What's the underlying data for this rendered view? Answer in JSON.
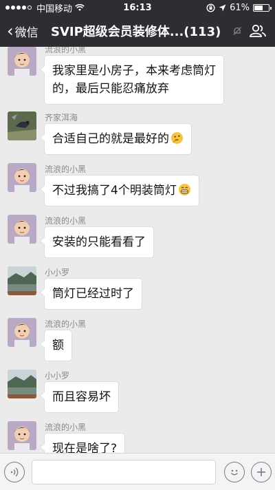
{
  "status_bar": {
    "carrier": "中国移动",
    "time": "16:13",
    "battery": "61%",
    "battery_level": 0.61
  },
  "nav": {
    "back_label": "微信",
    "title": "SVIP超级会员装修体...(113)"
  },
  "messages": [
    {
      "sender": "流浪的小黑",
      "avatar": "child-photo",
      "lines": [
        "我家里是小房子，本来考虑筒灯",
        "的，最后只能忍痛放弃"
      ]
    },
    {
      "sender": "齐家洱海",
      "avatar": "bird-photo",
      "lines": [
        "合适自己的就是最好的"
      ],
      "emoji": "thinking-face"
    },
    {
      "sender": "流浪的小黑",
      "avatar": "child-photo",
      "lines": [
        "不过我搞了4个明装筒灯"
      ],
      "emoji": "grinning-face"
    },
    {
      "sender": "流浪的小黑",
      "avatar": "child-photo",
      "lines": [
        "安装的只能看看了"
      ]
    },
    {
      "sender": "小小罗",
      "avatar": "lake-photo",
      "lines": [
        "筒灯已经过时了"
      ]
    },
    {
      "sender": "流浪的小黑",
      "avatar": "child-photo",
      "lines": [
        "额"
      ]
    },
    {
      "sender": "小小罗",
      "avatar": "lake-photo",
      "lines": [
        "而且容易坏"
      ]
    },
    {
      "sender": "流浪的小黑",
      "avatar": "child-photo",
      "lines": [
        "现在是啥了?"
      ]
    }
  ],
  "input_bar": {
    "voice_icon": "voice-icon",
    "emoji_icon": "emoji-face-icon",
    "plus_icon": "plus-icon"
  }
}
